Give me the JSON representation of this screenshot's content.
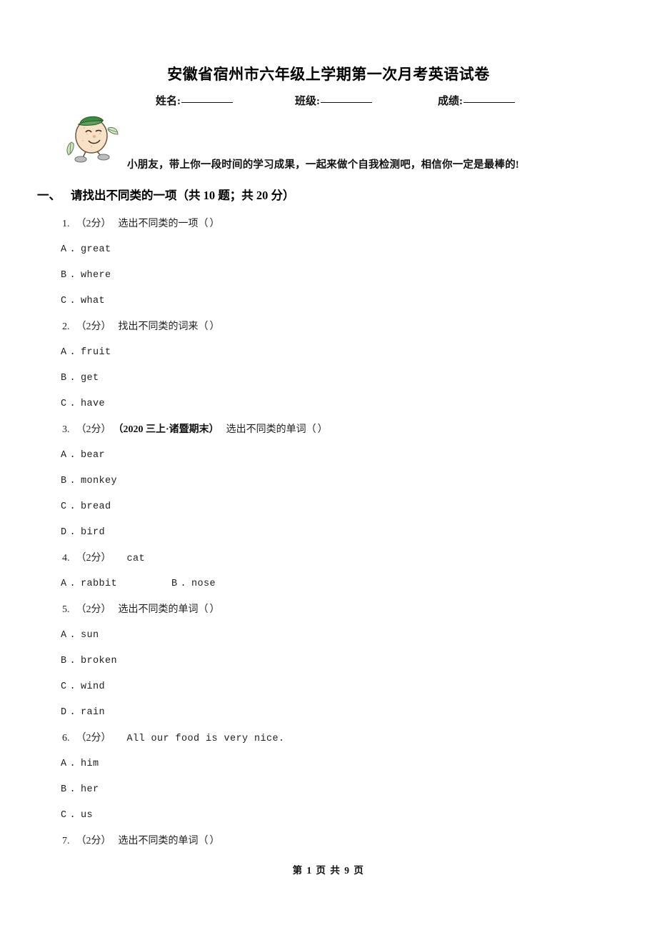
{
  "document": {
    "title": "安徽省宿州市六年级上学期第一次月考英语试卷",
    "greeting": "小朋友，带上你一段时间的学习成果，一起来做个自我检测吧，相信你一定是最棒的!",
    "mascot_icon": "cartoon-egg-character-icon"
  },
  "id_fields": {
    "name_label": "姓名:",
    "class_label": "班级:",
    "score_label": "成绩:"
  },
  "section": {
    "number": "一、",
    "title": "请找出不同类的一项（共 10 题；共 20 分）"
  },
  "questions": [
    {
      "num": "1.",
      "score": "（2分）",
      "source": "",
      "stem": "选出不同类的一项（",
      "stem_mono": false,
      "close_paren": "）",
      "inline_options": false,
      "options": [
        {
          "letter": "A",
          "text": "great"
        },
        {
          "letter": "B",
          "text": "where"
        },
        {
          "letter": "C",
          "text": "what"
        }
      ]
    },
    {
      "num": "2.",
      "score": "（2分）",
      "source": "",
      "stem": "找出不同类的词来（",
      "stem_mono": false,
      "close_paren": "）",
      "inline_options": false,
      "options": [
        {
          "letter": "A",
          "text": "fruit"
        },
        {
          "letter": "B",
          "text": "get"
        },
        {
          "letter": "C",
          "text": "have"
        }
      ]
    },
    {
      "num": "3.",
      "score": "（2分）",
      "source": "（2020 三上·诸暨期末）",
      "stem": "选出不同类的单词（",
      "stem_mono": false,
      "close_paren": "）",
      "inline_options": false,
      "options": [
        {
          "letter": "A",
          "text": "bear"
        },
        {
          "letter": "B",
          "text": "monkey"
        },
        {
          "letter": "C",
          "text": "bread"
        },
        {
          "letter": "D",
          "text": "bird"
        }
      ]
    },
    {
      "num": "4.",
      "score": "（2分）",
      "source": "",
      "stem": "cat",
      "stem_mono": true,
      "close_paren": "",
      "inline_options": true,
      "options": [
        {
          "letter": "A",
          "text": "rabbit"
        },
        {
          "letter": "B",
          "text": "nose"
        }
      ]
    },
    {
      "num": "5.",
      "score": "（2分）",
      "source": "",
      "stem": "选出不同类的单词（",
      "stem_mono": false,
      "close_paren": "）",
      "inline_options": false,
      "options": [
        {
          "letter": "A",
          "text": "sun"
        },
        {
          "letter": "B",
          "text": "broken"
        },
        {
          "letter": "C",
          "text": "wind"
        },
        {
          "letter": "D",
          "text": "rain"
        }
      ]
    },
    {
      "num": "6.",
      "score": "（2分）",
      "source": "",
      "stem": "All our food is very nice.",
      "stem_mono": true,
      "close_paren": "",
      "inline_options": false,
      "options": [
        {
          "letter": "A",
          "text": "him"
        },
        {
          "letter": "B",
          "text": "her"
        },
        {
          "letter": "C",
          "text": "us"
        }
      ]
    },
    {
      "num": "7.",
      "score": "（2分）",
      "source": "",
      "stem": "选出不同类的单词（",
      "stem_mono": false,
      "close_paren": "）",
      "inline_options": false,
      "options": []
    }
  ],
  "footer": {
    "text": "第 1 页 共 9 页"
  }
}
